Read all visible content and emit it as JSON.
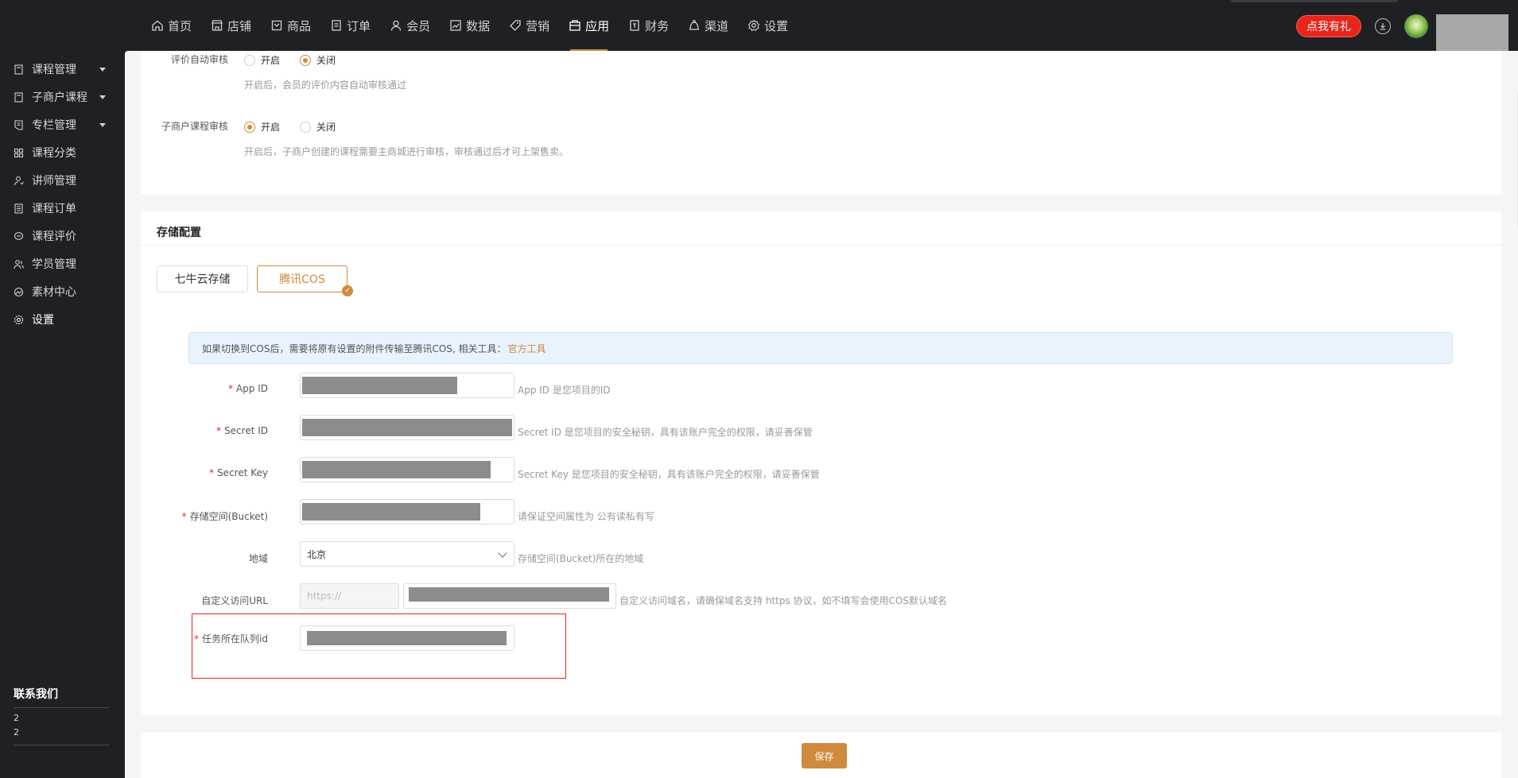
{
  "nav": {
    "items": [
      {
        "label": "首页",
        "icon": "home-icon"
      },
      {
        "label": "店铺",
        "icon": "store-icon"
      },
      {
        "label": "商品",
        "icon": "goods-icon"
      },
      {
        "label": "订单",
        "icon": "order-icon"
      },
      {
        "label": "会员",
        "icon": "member-icon"
      },
      {
        "label": "数据",
        "icon": "chart-icon"
      },
      {
        "label": "营销",
        "icon": "tag-icon"
      },
      {
        "label": "应用",
        "icon": "app-icon",
        "active": true
      },
      {
        "label": "财务",
        "icon": "finance-icon"
      },
      {
        "label": "渠道",
        "icon": "channel-icon"
      },
      {
        "label": "设置",
        "icon": "gear-icon"
      }
    ],
    "gift_label": "点我有礼"
  },
  "sidebar": {
    "items": [
      {
        "label": "课程管理",
        "icon": "book-icon",
        "expandable": true
      },
      {
        "label": "子商户课程",
        "icon": "book-icon",
        "expandable": true
      },
      {
        "label": "专栏管理",
        "icon": "column-icon",
        "expandable": true
      },
      {
        "label": "课程分类",
        "icon": "grid-icon"
      },
      {
        "label": "讲师管理",
        "icon": "teacher-icon"
      },
      {
        "label": "课程订单",
        "icon": "list-icon"
      },
      {
        "label": "课程评价",
        "icon": "comment-icon"
      },
      {
        "label": "学员管理",
        "icon": "student-icon"
      },
      {
        "label": "素材中心",
        "icon": "material-icon"
      },
      {
        "label": "设置",
        "icon": "gear-icon",
        "active": true
      }
    ],
    "contact": {
      "title": "联系我们",
      "line1": "2",
      "line2": "2"
    }
  },
  "review": {
    "auto_label": "评价自动审核",
    "auto_on": "开启",
    "auto_off": "关闭",
    "auto_hint": "开启后，会员的评价内容自动审核通过",
    "sub_label": "子商户课程审核",
    "sub_on": "开启",
    "sub_off": "关闭",
    "sub_hint": "开启后，子商户创建的课程需要主商城进行审核，审核通过后才可上架售卖。"
  },
  "storage": {
    "title": "存储配置",
    "tabs": [
      "七牛云存储",
      "腾讯COS"
    ],
    "selected_tab": 1,
    "alert_text": "如果切换到COS后，需要将原有设置的附件传输至腾讯COS, 相关工具：",
    "alert_link": "官方工具",
    "fields": {
      "app_id": {
        "label": "App ID",
        "hint": "App ID 是您项目的ID"
      },
      "secret_id": {
        "label": "Secret ID",
        "hint": "Secret ID 是您项目的安全秘钥，具有该账户完全的权限，请妥善保管"
      },
      "secret_key": {
        "label": "Secret Key",
        "hint": "Secret Key 是您项目的安全秘钥，具有该账户完全的权限，请妥善保管"
      },
      "bucket": {
        "label": "存储空间(Bucket)",
        "hint": "请保证空间属性为 公有读私有写"
      },
      "region": {
        "label": "地域",
        "value": "北京",
        "hint": "存储空间(Bucket)所在的地域"
      },
      "custom_url": {
        "label": "自定义访问URL",
        "prefix": "https://",
        "hint": "自定义访问域名，请确保域名支持 https 协议，如不填写会使用COS默认域名"
      },
      "queue_id": {
        "label": "任务所在队列id"
      }
    },
    "save_label": "保存"
  },
  "colors": {
    "accent": "#d08a3e",
    "danger": "#e8251c",
    "sidebar_bg": "#1f2024"
  }
}
